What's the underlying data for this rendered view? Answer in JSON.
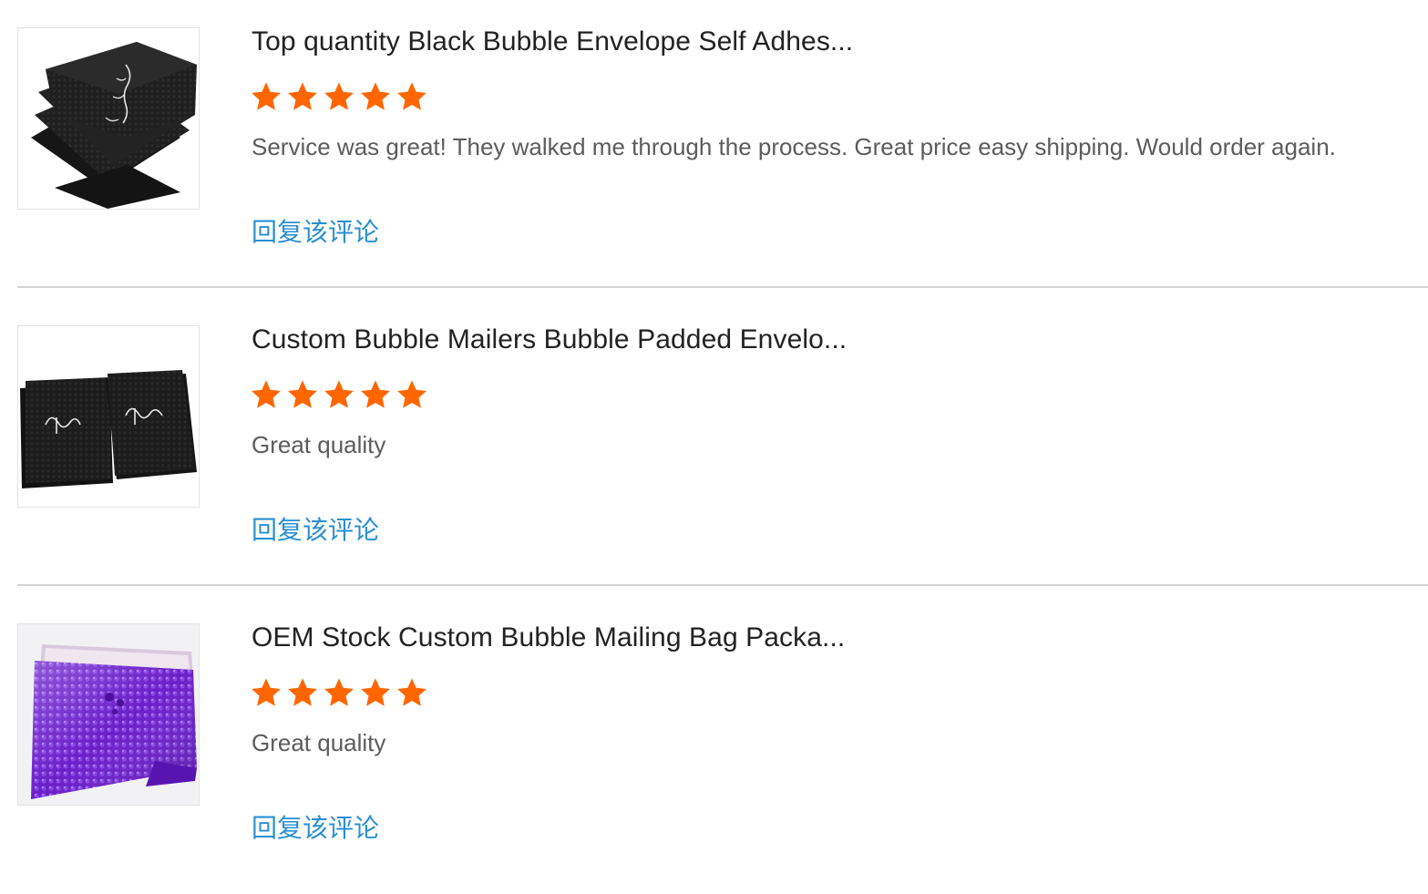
{
  "reviews": [
    {
      "product_title": "Top quantity Black Bubble Envelope Self Adhes...",
      "rating": 5,
      "rating_max": 5,
      "comment": "Service was great! They walked me through the process. Great price easy shipping. Would order again.",
      "reply_label": "回复该评论",
      "thumbnail": "black-bubble-envelopes-stack"
    },
    {
      "product_title": "Custom Bubble Mailers Bubble Padded Envelo...",
      "rating": 5,
      "rating_max": 5,
      "comment": "Great quality",
      "reply_label": "回复该评论",
      "thumbnail": "black-bubble-mailers-pair"
    },
    {
      "product_title": "OEM Stock Custom Bubble Mailing Bag Packa...",
      "rating": 5,
      "rating_max": 5,
      "comment": "Great quality",
      "reply_label": "回复该评论",
      "thumbnail": "purple-metallic-bubble-mailer"
    }
  ],
  "colors": {
    "star": "#ff6600",
    "reply_link": "#2a8fd1",
    "title": "#222222",
    "comment": "#5c5c5c",
    "divider": "#d4d4d4"
  },
  "icons": {
    "star": "star-icon"
  }
}
